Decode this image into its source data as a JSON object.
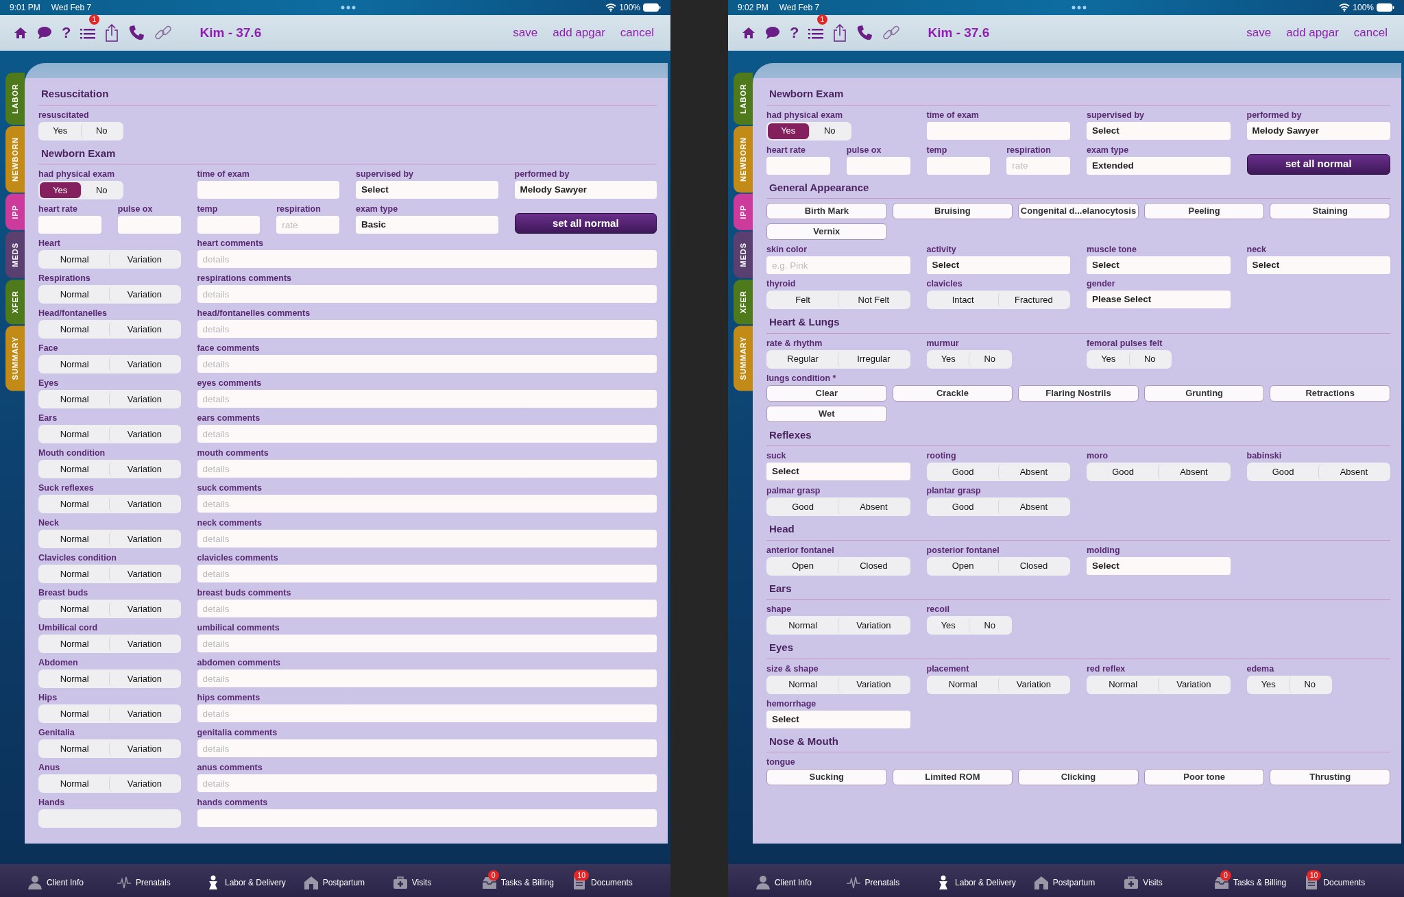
{
  "screens": [
    {
      "status_bar": {
        "time": "9:01 PM",
        "date": "Wed Feb 7",
        "battery": "100%"
      },
      "toolbar": {
        "help": "?",
        "alert_count": "1",
        "title": "Kim - 37.6",
        "actions": [
          "save",
          "add apgar",
          "cancel"
        ]
      },
      "side_tabs": [
        {
          "label": "LABOR",
          "color": "#4e7a1c"
        },
        {
          "label": "NEWBORN",
          "color": "#c28a16"
        },
        {
          "label": "IPP",
          "color": "#cc3a9c"
        },
        {
          "label": "MEDS",
          "color": "#5a4070"
        },
        {
          "label": "XFER",
          "color": "#4e7a1c"
        },
        {
          "label": "SUMMARY",
          "color": "#c28a16"
        }
      ],
      "sections": [
        {
          "title": "Resuscitation",
          "fields": [
            {
              "kind": "toggle",
              "label": "resuscitated",
              "options": [
                {
                  "label": "Yes",
                  "selected": false
                },
                {
                  "label": "No",
                  "selected": false
                }
              ]
            }
          ]
        },
        {
          "title": "Newborn Exam",
          "fields": [
            {
              "kind": "toggle",
              "label": "had physical exam",
              "options": [
                {
                  "label": "Yes",
                  "selected": true
                },
                {
                  "label": "No",
                  "selected": false
                }
              ]
            },
            {
              "kind": "input",
              "label": "time of exam"
            },
            {
              "kind": "select",
              "label": "supervised by",
              "value": "Select"
            },
            {
              "kind": "select",
              "label": "performed by",
              "value": "Melody Sawyer"
            },
            {
              "kind": "short",
              "label": "heart rate"
            },
            {
              "kind": "short",
              "label": "pulse ox"
            },
            {
              "kind": "short",
              "label": "temp"
            },
            {
              "kind": "short",
              "label": "respiration",
              "placeholder": "rate"
            },
            {
              "kind": "select",
              "label": "exam type",
              "value": "Basic"
            },
            {
              "kind": "action",
              "text": "set all normal"
            },
            {
              "kind": "segmented",
              "label": "Heart",
              "options": [
                {
                  "label": "Normal",
                  "selected": false
                },
                {
                  "label": "Variation",
                  "selected": false
                }
              ]
            },
            {
              "kind": "comment",
              "label": "heart comments",
              "placeholder": "details"
            },
            {
              "kind": "segmented",
              "label": "Respirations",
              "options": [
                {
                  "label": "Normal",
                  "selected": false
                },
                {
                  "label": "Variation",
                  "selected": false
                }
              ]
            },
            {
              "kind": "comment",
              "label": "respirations comments",
              "placeholder": "details"
            },
            {
              "kind": "segmented",
              "label": "Head/fontanelles",
              "options": [
                {
                  "label": "Normal",
                  "selected": false
                },
                {
                  "label": "Variation",
                  "selected": false
                }
              ]
            },
            {
              "kind": "comment",
              "label": "head/fontanelles comments",
              "placeholder": "details"
            },
            {
              "kind": "segmented",
              "label": "Face",
              "options": [
                {
                  "label": "Normal",
                  "selected": false
                },
                {
                  "label": "Variation",
                  "selected": false
                }
              ]
            },
            {
              "kind": "comment",
              "label": "face comments",
              "placeholder": "details"
            },
            {
              "kind": "segmented",
              "label": "Eyes",
              "options": [
                {
                  "label": "Normal",
                  "selected": false
                },
                {
                  "label": "Variation",
                  "selected": false
                }
              ]
            },
            {
              "kind": "comment",
              "label": "eyes comments",
              "placeholder": "details"
            },
            {
              "kind": "segmented",
              "label": "Ears",
              "options": [
                {
                  "label": "Normal",
                  "selected": false
                },
                {
                  "label": "Variation",
                  "selected": false
                }
              ]
            },
            {
              "kind": "comment",
              "label": "ears comments",
              "placeholder": "details"
            },
            {
              "kind": "segmented",
              "label": "Mouth condition",
              "options": [
                {
                  "label": "Normal",
                  "selected": false
                },
                {
                  "label": "Variation",
                  "selected": false
                }
              ]
            },
            {
              "kind": "comment",
              "label": "mouth comments",
              "placeholder": "details"
            },
            {
              "kind": "segmented",
              "label": "Suck reflexes",
              "options": [
                {
                  "label": "Normal",
                  "selected": false
                },
                {
                  "label": "Variation",
                  "selected": false
                }
              ]
            },
            {
              "kind": "comment",
              "label": "suck comments",
              "placeholder": "details"
            },
            {
              "kind": "segmented",
              "label": "Neck",
              "options": [
                {
                  "label": "Normal",
                  "selected": false
                },
                {
                  "label": "Variation",
                  "selected": false
                }
              ]
            },
            {
              "kind": "comment",
              "label": "neck comments",
              "placeholder": "details"
            },
            {
              "kind": "segmented",
              "label": "Clavicles condition",
              "options": [
                {
                  "label": "Normal",
                  "selected": false
                },
                {
                  "label": "Variation",
                  "selected": false
                }
              ]
            },
            {
              "kind": "comment",
              "label": "clavicles comments",
              "placeholder": "details"
            },
            {
              "kind": "segmented",
              "label": "Breast buds",
              "options": [
                {
                  "label": "Normal",
                  "selected": false
                },
                {
                  "label": "Variation",
                  "selected": false
                }
              ]
            },
            {
              "kind": "comment",
              "label": "breast buds comments",
              "placeholder": "details"
            },
            {
              "kind": "segmented",
              "label": "Umbilical cord",
              "options": [
                {
                  "label": "Normal",
                  "selected": false
                },
                {
                  "label": "Variation",
                  "selected": false
                }
              ]
            },
            {
              "kind": "comment",
              "label": "umbilical comments",
              "placeholder": "details"
            },
            {
              "kind": "segmented",
              "label": "Abdomen",
              "options": [
                {
                  "label": "Normal",
                  "selected": false
                },
                {
                  "label": "Variation",
                  "selected": false
                }
              ]
            },
            {
              "kind": "comment",
              "label": "abdomen comments",
              "placeholder": "details"
            },
            {
              "kind": "segmented",
              "label": "Hips",
              "options": [
                {
                  "label": "Normal",
                  "selected": false
                },
                {
                  "label": "Variation",
                  "selected": false
                }
              ]
            },
            {
              "kind": "comment",
              "label": "hips comments",
              "placeholder": "details"
            },
            {
              "kind": "segmented",
              "label": "Genitalia",
              "options": [
                {
                  "label": "Normal",
                  "selected": false
                },
                {
                  "label": "Variation",
                  "selected": false
                }
              ]
            },
            {
              "kind": "comment",
              "label": "genitalia comments",
              "placeholder": "details"
            },
            {
              "kind": "segmented",
              "label": "Anus",
              "options": [
                {
                  "label": "Normal",
                  "selected": false
                },
                {
                  "label": "Variation",
                  "selected": false
                }
              ]
            },
            {
              "kind": "comment",
              "label": "anus comments",
              "placeholder": "details"
            },
            {
              "kind": "segmented",
              "label": "Hands"
            },
            {
              "kind": "comment",
              "label": "hands comments"
            }
          ]
        }
      ],
      "bottom_tabs": [
        {
          "label": "Client Info"
        },
        {
          "label": "Prenatals"
        },
        {
          "label": "Labor & Delivery"
        },
        {
          "label": "Postpartum"
        },
        {
          "label": "Visits"
        },
        {
          "label": "Tasks & Billing",
          "badge": "0"
        },
        {
          "label": "Documents",
          "badge": "10"
        }
      ]
    },
    {
      "status_bar": {
        "time": "9:02 PM",
        "date": "Wed Feb 7",
        "battery": "100%"
      },
      "toolbar": {
        "help": "?",
        "alert_count": "1",
        "title": "Kim - 37.6",
        "actions": [
          "save",
          "add apgar",
          "cancel"
        ]
      },
      "side_tabs": [
        {
          "label": "LABOR",
          "color": "#4e7a1c"
        },
        {
          "label": "NEWBORN",
          "color": "#c28a16"
        },
        {
          "label": "IPP",
          "color": "#cc3a9c"
        },
        {
          "label": "MEDS",
          "color": "#5a4070"
        },
        {
          "label": "XFER",
          "color": "#4e7a1c"
        },
        {
          "label": "SUMMARY",
          "color": "#c28a16"
        }
      ],
      "sections": [
        {
          "title": "Newborn Exam",
          "fields": [
            {
              "kind": "toggle",
              "label": "had physical exam",
              "options": [
                {
                  "label": "Yes",
                  "selected": true
                },
                {
                  "label": "No",
                  "selected": false
                }
              ]
            },
            {
              "kind": "input",
              "label": "time of exam"
            },
            {
              "kind": "select",
              "label": "supervised by",
              "value": "Select"
            },
            {
              "kind": "select",
              "label": "performed by",
              "value": "Melody Sawyer"
            },
            {
              "kind": "short",
              "label": "heart rate"
            },
            {
              "kind": "short",
              "label": "pulse ox"
            },
            {
              "kind": "short",
              "label": "temp"
            },
            {
              "kind": "short",
              "label": "respiration",
              "placeholder": "rate"
            },
            {
              "kind": "select",
              "label": "exam type",
              "value": "Extended"
            },
            {
              "kind": "action",
              "text": "set all normal"
            }
          ]
        },
        {
          "title": "General Appearance",
          "fields": [
            {
              "kind": "chips",
              "chips": [
                "Birth Mark",
                "Bruising",
                "Congenital d...elanocytosis",
                "Peeling",
                "Staining",
                "Vernix"
              ]
            },
            {
              "kind": "input",
              "label": "skin color",
              "placeholder": "e.g. Pink"
            },
            {
              "kind": "select",
              "label": "activity",
              "value": "Select"
            },
            {
              "kind": "select",
              "label": "muscle tone",
              "value": "Select"
            },
            {
              "kind": "select",
              "label": "neck",
              "value": "Select"
            },
            {
              "kind": "segmented",
              "label": "thyroid",
              "options": [
                {
                  "label": "Felt",
                  "selected": false
                },
                {
                  "label": "Not Felt",
                  "selected": false
                }
              ]
            },
            {
              "kind": "segmented",
              "label": "clavicles",
              "options": [
                {
                  "label": "Intact",
                  "selected": false
                },
                {
                  "label": "Fractured",
                  "selected": false
                }
              ]
            },
            {
              "kind": "select",
              "label": "gender",
              "value": "Please Select"
            }
          ]
        },
        {
          "title": "Heart & Lungs",
          "fields": [
            {
              "kind": "segmented",
              "label": "rate & rhythm",
              "options": [
                {
                  "label": "Regular",
                  "selected": false
                },
                {
                  "label": "Irregular",
                  "selected": false
                }
              ]
            },
            {
              "kind": "toggle",
              "label": "murmur",
              "options": [
                {
                  "label": "Yes",
                  "selected": false
                },
                {
                  "label": "No",
                  "selected": false
                }
              ]
            },
            {
              "kind": "toggle",
              "label": "femoral pulses felt",
              "options": [
                {
                  "label": "Yes",
                  "selected": false
                },
                {
                  "label": "No",
                  "selected": false
                }
              ]
            },
            {
              "kind": "chips",
              "label": "lungs condition *",
              "chips": [
                "Clear",
                "Crackle",
                "Flaring Nostrils",
                "Grunting",
                "Retractions",
                "Wet"
              ]
            }
          ]
        },
        {
          "title": "Reflexes",
          "fields": [
            {
              "kind": "select",
              "label": "suck",
              "value": "Select"
            },
            {
              "kind": "segmented",
              "label": "rooting",
              "options": [
                {
                  "label": "Good",
                  "selected": false
                },
                {
                  "label": "Absent",
                  "selected": false
                }
              ]
            },
            {
              "kind": "segmented",
              "label": "moro",
              "options": [
                {
                  "label": "Good",
                  "selected": false
                },
                {
                  "label": "Absent",
                  "selected": false
                }
              ]
            },
            {
              "kind": "segmented",
              "label": "babinski",
              "options": [
                {
                  "label": "Good",
                  "selected": false
                },
                {
                  "label": "Absent",
                  "selected": false
                }
              ]
            },
            {
              "kind": "segmented",
              "label": "palmar grasp",
              "options": [
                {
                  "label": "Good",
                  "selected": false
                },
                {
                  "label": "Absent",
                  "selected": false
                }
              ]
            },
            {
              "kind": "segmented",
              "label": "plantar grasp",
              "options": [
                {
                  "label": "Good",
                  "selected": false
                },
                {
                  "label": "Absent",
                  "selected": false
                }
              ]
            }
          ]
        },
        {
          "title": "Head",
          "fields": [
            {
              "kind": "segmented",
              "label": "anterior fontanel",
              "options": [
                {
                  "label": "Open",
                  "selected": false
                },
                {
                  "label": "Closed",
                  "selected": false
                }
              ]
            },
            {
              "kind": "segmented",
              "label": "posterior fontanel",
              "options": [
                {
                  "label": "Open",
                  "selected": false
                },
                {
                  "label": "Closed",
                  "selected": false
                }
              ]
            },
            {
              "kind": "select",
              "label": "molding",
              "value": "Select"
            }
          ]
        },
        {
          "title": "Ears",
          "fields": [
            {
              "kind": "segmented",
              "label": "shape",
              "options": [
                {
                  "label": "Normal",
                  "selected": false
                },
                {
                  "label": "Variation",
                  "selected": false
                }
              ]
            },
            {
              "kind": "toggle",
              "label": "recoil",
              "options": [
                {
                  "label": "Yes",
                  "selected": false
                },
                {
                  "label": "No",
                  "selected": false
                }
              ]
            }
          ]
        },
        {
          "title": "Eyes",
          "fields": [
            {
              "kind": "segmented",
              "label": "size & shape",
              "options": [
                {
                  "label": "Normal",
                  "selected": false
                },
                {
                  "label": "Variation",
                  "selected": false
                }
              ]
            },
            {
              "kind": "segmented",
              "label": "placement",
              "options": [
                {
                  "label": "Normal",
                  "selected": false
                },
                {
                  "label": "Variation",
                  "selected": false
                }
              ]
            },
            {
              "kind": "segmented",
              "label": "red reflex",
              "options": [
                {
                  "label": "Normal",
                  "selected": false
                },
                {
                  "label": "Variation",
                  "selected": false
                }
              ]
            },
            {
              "kind": "toggle",
              "label": "edema",
              "options": [
                {
                  "label": "Yes",
                  "selected": false
                },
                {
                  "label": "No",
                  "selected": false
                }
              ]
            },
            {
              "kind": "select",
              "label": "hemorrhage",
              "value": "Select"
            }
          ]
        },
        {
          "title": "Nose & Mouth",
          "fields": [
            {
              "kind": "chips",
              "label": "tongue",
              "chips": [
                "Sucking",
                "Limited ROM",
                "Clicking",
                "Poor tone",
                "Thrusting"
              ]
            }
          ]
        }
      ],
      "bottom_tabs": [
        {
          "label": "Client Info"
        },
        {
          "label": "Prenatals"
        },
        {
          "label": "Labor & Delivery"
        },
        {
          "label": "Postpartum"
        },
        {
          "label": "Visits"
        },
        {
          "label": "Tasks & Billing",
          "badge": "0"
        },
        {
          "label": "Documents",
          "badge": "10"
        }
      ]
    }
  ]
}
